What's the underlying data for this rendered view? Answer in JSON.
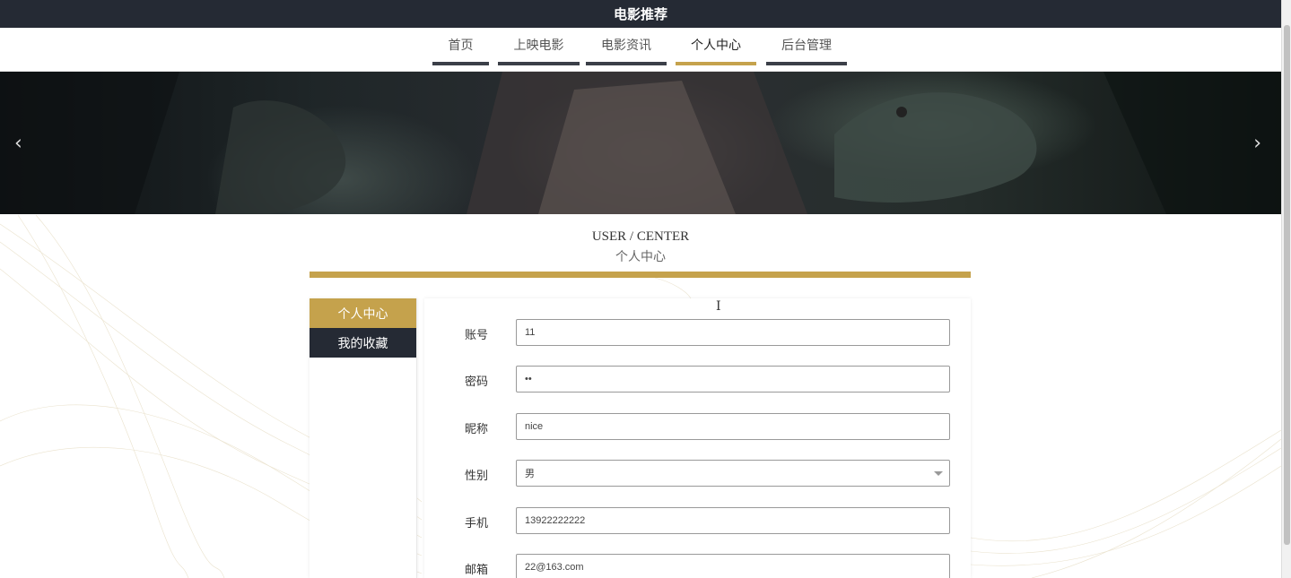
{
  "header": {
    "title": "电影推荐"
  },
  "nav": {
    "items": [
      {
        "label": "首页"
      },
      {
        "label": "上映电影"
      },
      {
        "label": "电影资讯"
      },
      {
        "label": "个人中心"
      },
      {
        "label": "后台管理"
      }
    ],
    "active": "个人中心"
  },
  "banner": {
    "prev_icon": "chevron-left-icon",
    "next_icon": "chevron-right-icon"
  },
  "section": {
    "title_en": "USER / CENTER",
    "title_cn": "个人中心"
  },
  "sidebar": {
    "items": [
      {
        "label": "个人中心"
      },
      {
        "label": "我的收藏"
      }
    ]
  },
  "form": {
    "account": {
      "label": "账号",
      "value": "11"
    },
    "password": {
      "label": "密码",
      "value": "••"
    },
    "nickname": {
      "label": "昵称",
      "value": "nice"
    },
    "gender": {
      "label": "性别",
      "value": "男"
    },
    "phone": {
      "label": "手机",
      "value": "13922222222"
    },
    "email": {
      "label": "邮箱",
      "value": "22@163.com"
    }
  },
  "colors": {
    "accent": "#c5a24c",
    "dark": "#252a34"
  }
}
